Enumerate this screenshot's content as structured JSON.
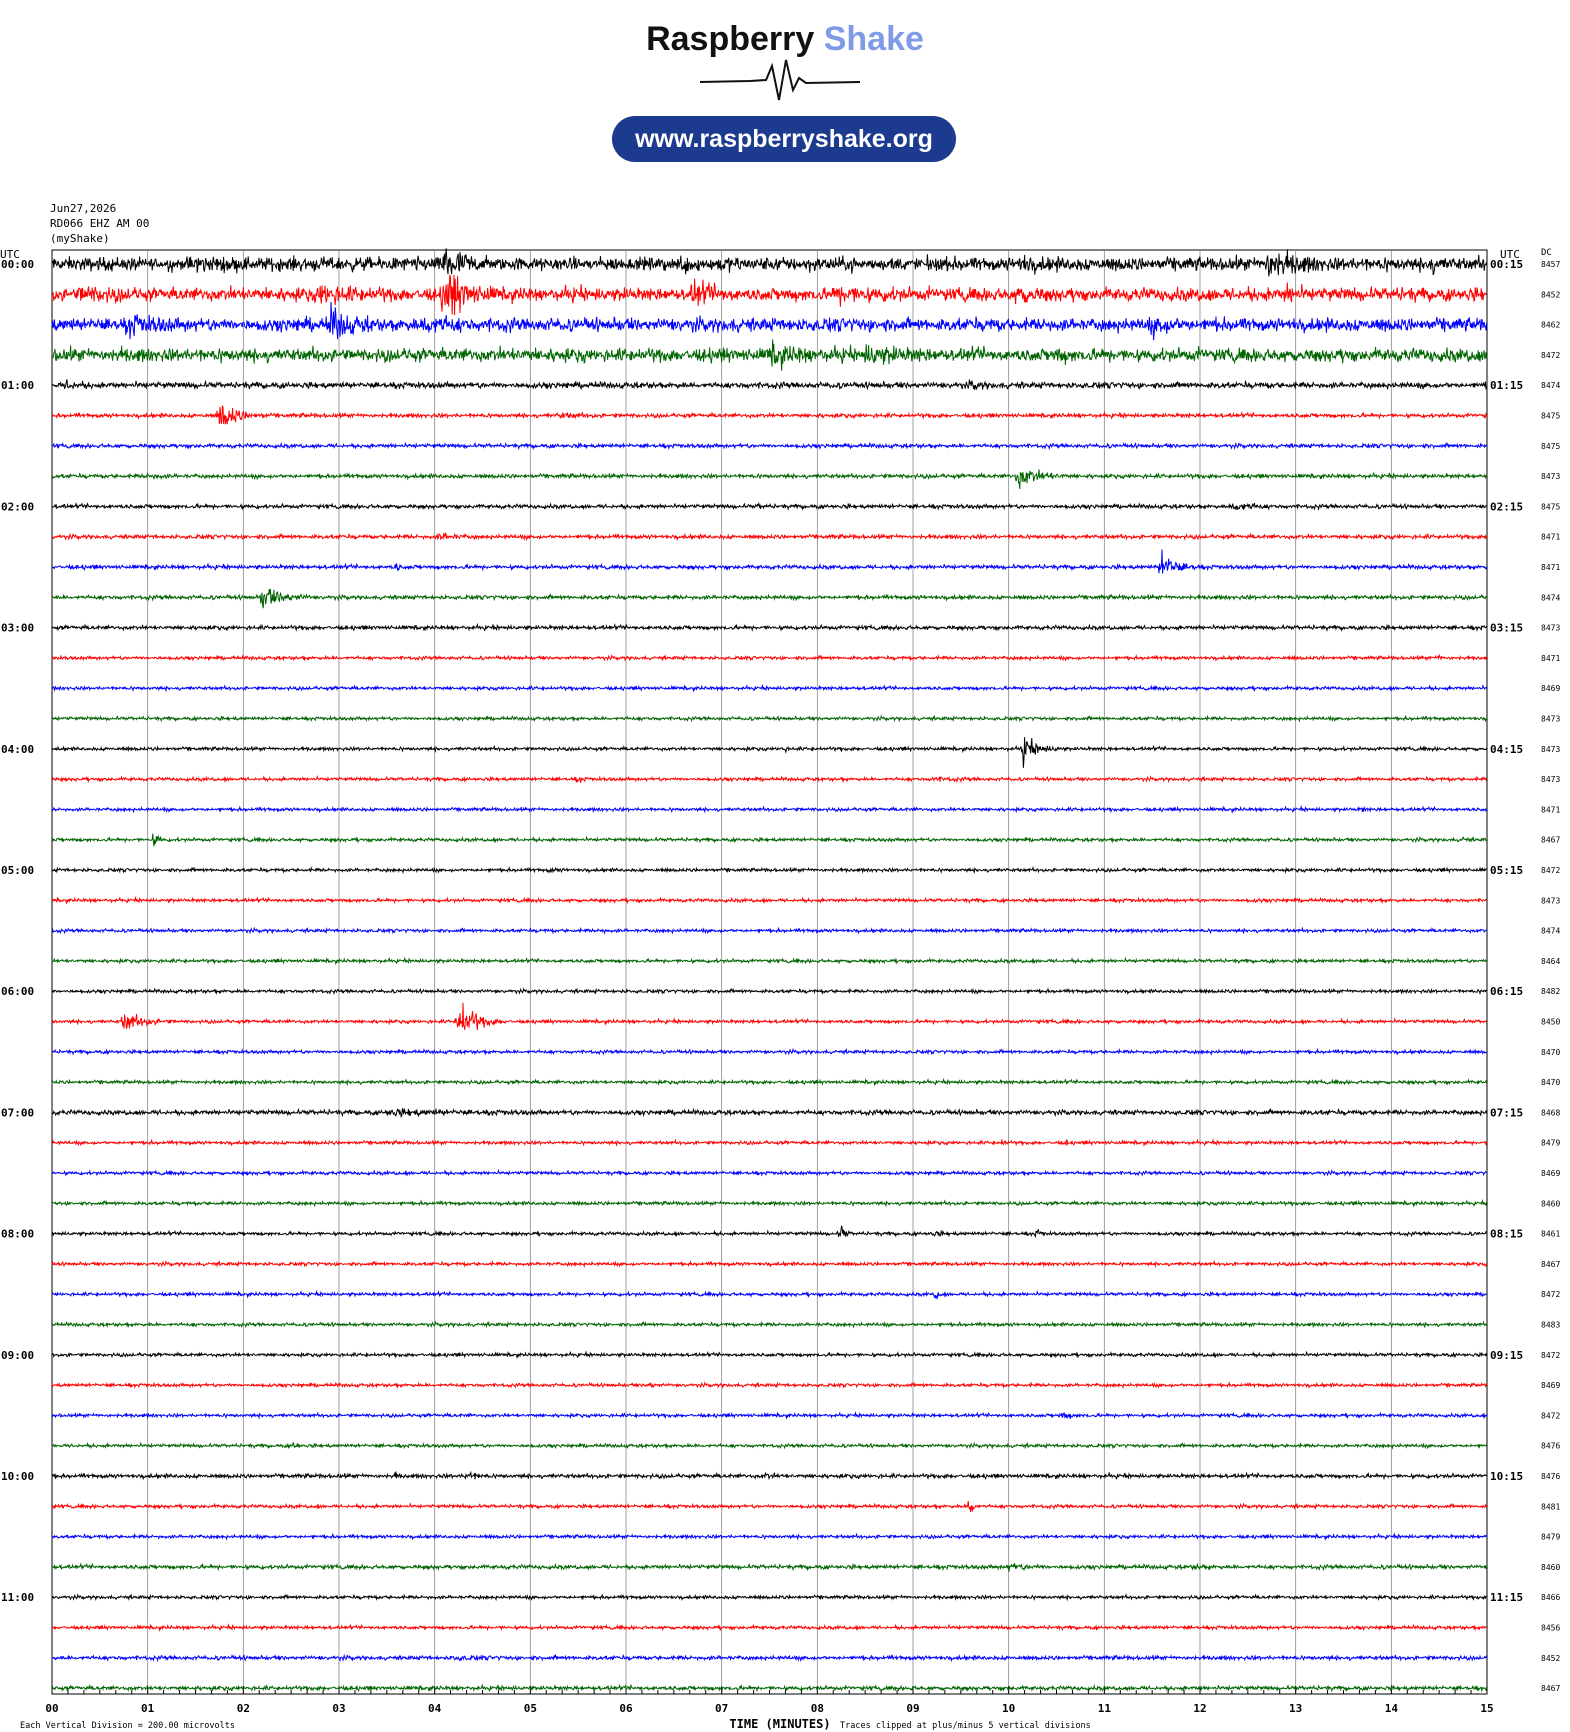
{
  "header": {
    "brand_part1": "Raspberry",
    "brand_part2": "Shake",
    "url": "www.raspberryshake.org",
    "date": "Jun27,2026",
    "station": "RD066 EHZ AM 00",
    "network_label": "(myShake)"
  },
  "colors": {
    "trace_cycle": [
      "#000000",
      "#ff0000",
      "#0000ff",
      "#006400"
    ],
    "brand_accent": "#7f9ae6",
    "url_pill": "#1c3b8f",
    "grid": "#888888"
  },
  "chart_data": {
    "type": "line",
    "title": "",
    "left_axis_title": "UTC",
    "right_axis_title": "UTC",
    "dc_title": "DC",
    "xlabel": "TIME (MINUTES)",
    "xlim": [
      0,
      15
    ],
    "x_ticks": [
      "00",
      "01",
      "02",
      "03",
      "04",
      "05",
      "06",
      "07",
      "08",
      "09",
      "10",
      "11",
      "12",
      "13",
      "14",
      "15"
    ],
    "row_count": 48,
    "row_minutes": 15,
    "left_time_labels": [
      "00:00",
      "01:00",
      "02:00",
      "03:00",
      "04:00",
      "05:00",
      "06:00",
      "07:00",
      "08:00",
      "09:00",
      "10:00",
      "11:00"
    ],
    "right_time_labels": [
      "00:15",
      "01:15",
      "02:15",
      "03:15",
      "04:15",
      "05:15",
      "06:15",
      "07:15",
      "08:15",
      "09:15",
      "10:15",
      "11:15"
    ],
    "dc_values": [
      "8457",
      "8452",
      "8462",
      "8472",
      "8474",
      "8475",
      "8475",
      "8473",
      "8475",
      "8471",
      "8471",
      "8474",
      "8473",
      "8471",
      "8469",
      "8473",
      "8473",
      "8473",
      "8471",
      "8467",
      "8472",
      "8473",
      "8474",
      "8464",
      "8482",
      "8450",
      "8470",
      "8470",
      "8468",
      "8479",
      "8469",
      "8460",
      "8461",
      "8467",
      "8472",
      "8483",
      "8472",
      "8469",
      "8472",
      "8476",
      "8476",
      "8481",
      "8479",
      "8460",
      "8466",
      "8456",
      "8452",
      "8467"
    ],
    "footer_left": "Each Vertical Division =  200.00 microvolts",
    "footer_right": "Traces clipped at plus/minus 5 vertical divisions",
    "noise_levels": [
      1.0,
      1.0,
      1.0,
      1.0,
      0.45,
      0.3,
      0.3,
      0.3,
      0.3,
      0.3,
      0.3,
      0.3,
      0.3,
      0.25,
      0.25,
      0.25,
      0.25,
      0.25,
      0.25,
      0.25,
      0.25,
      0.25,
      0.25,
      0.25,
      0.25,
      0.25,
      0.25,
      0.25,
      0.35,
      0.25,
      0.25,
      0.25,
      0.25,
      0.25,
      0.25,
      0.25,
      0.25,
      0.25,
      0.25,
      0.25,
      0.3,
      0.25,
      0.25,
      0.3,
      0.25,
      0.25,
      0.3,
      0.3
    ],
    "events": [
      {
        "row": 0,
        "minute": 1.45,
        "duration": 0.6,
        "amplitude": 0.6
      },
      {
        "row": 0,
        "minute": 4.1,
        "duration": 0.5,
        "amplitude": 2.3
      },
      {
        "row": 0,
        "minute": 6.6,
        "duration": 0.8,
        "amplitude": 0.5
      },
      {
        "row": 0,
        "minute": 10.1,
        "duration": 0.6,
        "amplitude": 0.5
      },
      {
        "row": 0,
        "minute": 12.7,
        "duration": 0.6,
        "amplitude": 1.8
      },
      {
        "row": 0,
        "minute": 14.4,
        "duration": 0.3,
        "amplitude": 0.5
      },
      {
        "row": 1,
        "minute": 0.3,
        "duration": 0.6,
        "amplitude": 0.8
      },
      {
        "row": 1,
        "minute": 2.8,
        "duration": 0.7,
        "amplitude": 0.9
      },
      {
        "row": 1,
        "minute": 4.1,
        "duration": 0.6,
        "amplitude": 2.8
      },
      {
        "row": 1,
        "minute": 6.7,
        "duration": 0.5,
        "amplitude": 1.2
      },
      {
        "row": 1,
        "minute": 8.2,
        "duration": 0.8,
        "amplitude": 0.7
      },
      {
        "row": 1,
        "minute": 10.1,
        "duration": 0.4,
        "amplitude": 0.8
      },
      {
        "row": 1,
        "minute": 12.9,
        "duration": 0.2,
        "amplitude": 1.0
      },
      {
        "row": 2,
        "minute": 0.8,
        "duration": 0.7,
        "amplitude": 0.8
      },
      {
        "row": 2,
        "minute": 2.9,
        "duration": 0.5,
        "amplitude": 1.8
      },
      {
        "row": 2,
        "minute": 3.9,
        "duration": 0.5,
        "amplitude": 1.3
      },
      {
        "row": 2,
        "minute": 11.5,
        "duration": 0.5,
        "amplitude": 0.9
      },
      {
        "row": 3,
        "minute": 7.5,
        "duration": 0.7,
        "amplitude": 1.0
      },
      {
        "row": 3,
        "minute": 8.5,
        "duration": 0.8,
        "amplitude": 0.9
      },
      {
        "row": 3,
        "minute": 10.5,
        "duration": 0.3,
        "amplitude": 0.5
      },
      {
        "row": 4,
        "minute": 0.15,
        "duration": 0.3,
        "amplitude": 0.5
      },
      {
        "row": 4,
        "minute": 9.6,
        "duration": 0.3,
        "amplitude": 0.4
      },
      {
        "row": 5,
        "minute": 1.75,
        "duration": 0.5,
        "amplitude": 1.8
      },
      {
        "row": 5,
        "minute": 5.3,
        "duration": 0.5,
        "amplitude": 0.3
      },
      {
        "row": 7,
        "minute": 1.0,
        "duration": 0.3,
        "amplitude": 0.3
      },
      {
        "row": 7,
        "minute": 10.1,
        "duration": 0.5,
        "amplitude": 1.5
      },
      {
        "row": 8,
        "minute": 7.4,
        "duration": 0.1,
        "amplitude": 0.3
      },
      {
        "row": 8,
        "minute": 12.35,
        "duration": 0.4,
        "amplitude": 0.8
      },
      {
        "row": 9,
        "minute": 4.05,
        "duration": 0.4,
        "amplitude": 0.4
      },
      {
        "row": 10,
        "minute": 3.6,
        "duration": 0.05,
        "amplitude": 0.8
      },
      {
        "row": 10,
        "minute": 11.6,
        "duration": 0.4,
        "amplitude": 1.8
      },
      {
        "row": 11,
        "minute": 2.2,
        "duration": 0.5,
        "amplitude": 1.6
      },
      {
        "row": 13,
        "minute": 14.5,
        "duration": 0.1,
        "amplitude": 0.3
      },
      {
        "row": 16,
        "minute": 10.15,
        "duration": 0.4,
        "amplitude": 1.7
      },
      {
        "row": 16,
        "minute": 7.65,
        "duration": 0.05,
        "amplitude": 0.6
      },
      {
        "row": 17,
        "minute": 5.5,
        "duration": 0.1,
        "amplitude": 0.4
      },
      {
        "row": 17,
        "minute": 9.2,
        "duration": 0.5,
        "amplitude": 0.2
      },
      {
        "row": 18,
        "minute": 13.7,
        "duration": 0.05,
        "amplitude": 0.4
      },
      {
        "row": 19,
        "minute": 1.08,
        "duration": 0.08,
        "amplitude": 1.6
      },
      {
        "row": 19,
        "minute": 14.75,
        "duration": 0.1,
        "amplitude": 0.3
      },
      {
        "row": 20,
        "minute": 5.2,
        "duration": 0.2,
        "amplitude": 0.2
      },
      {
        "row": 21,
        "minute": 12.6,
        "duration": 0.1,
        "amplitude": 0.2
      },
      {
        "row": 22,
        "minute": 5.75,
        "duration": 0.05,
        "amplitude": 0.5
      },
      {
        "row": 25,
        "minute": 0.75,
        "duration": 0.5,
        "amplitude": 1.3
      },
      {
        "row": 25,
        "minute": 4.25,
        "duration": 0.5,
        "amplitude": 2.4
      },
      {
        "row": 28,
        "minute": 3.5,
        "duration": 1.5,
        "amplitude": 0.3
      },
      {
        "row": 29,
        "minute": 9.95,
        "duration": 0.05,
        "amplitude": 0.5
      },
      {
        "row": 29,
        "minute": 10.6,
        "duration": 0.05,
        "amplitude": 0.4
      },
      {
        "row": 32,
        "minute": 8.25,
        "duration": 0.1,
        "amplitude": 1.2
      },
      {
        "row": 32,
        "minute": 9.2,
        "duration": 0.3,
        "amplitude": 0.2
      },
      {
        "row": 32,
        "minute": 10.3,
        "duration": 0.1,
        "amplitude": 0.4
      },
      {
        "row": 34,
        "minute": 9.25,
        "duration": 0.05,
        "amplitude": 0.8
      },
      {
        "row": 37,
        "minute": 6.25,
        "duration": 0.1,
        "amplitude": 0.4
      },
      {
        "row": 38,
        "minute": 10.55,
        "duration": 0.3,
        "amplitude": 0.4
      },
      {
        "row": 39,
        "minute": 2.55,
        "duration": 0.05,
        "amplitude": 1.0
      },
      {
        "row": 40,
        "minute": 3.6,
        "duration": 0.05,
        "amplitude": 0.5
      },
      {
        "row": 40,
        "minute": 4.35,
        "duration": 0.2,
        "amplitude": 0.6
      },
      {
        "row": 40,
        "minute": 7.45,
        "duration": 0.2,
        "amplitude": 0.3
      },
      {
        "row": 41,
        "minute": 9.6,
        "duration": 0.08,
        "amplitude": 2.2
      },
      {
        "row": 43,
        "minute": 10.0,
        "duration": 0.5,
        "amplitude": 0.4
      },
      {
        "row": 43,
        "minute": 11.95,
        "duration": 0.3,
        "amplitude": 0.2
      },
      {
        "row": 46,
        "minute": 4.2,
        "duration": 0.5,
        "amplitude": 0.2
      }
    ]
  }
}
